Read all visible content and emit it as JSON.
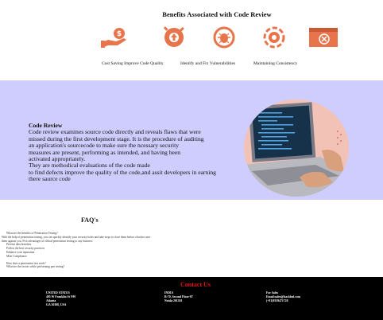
{
  "benefits": {
    "title": "Benefits Associated with Code Review",
    "items": [
      {
        "label": "Cost Saving Improve Code Quality",
        "icon": "dollar-hand-icon"
      },
      {
        "label": "",
        "icon": "cloud-upload-icon"
      },
      {
        "label": "Identify and Fix Vulnerabilities",
        "icon": "bug-icon"
      },
      {
        "label": "Maintaining Consistency",
        "icon": "gear-refresh-icon"
      },
      {
        "label": "",
        "icon": "browser-error-icon"
      }
    ],
    "icon_color": "#e8744c"
  },
  "review": {
    "heading": "Code Review",
    "lines": [
      "Code review examines source code directly and reveals flaws that were",
      "missed during the first development stage. It is the procedure of auditing",
      "an application's sourcecode to make sure the ncessary security",
      "measures are present, performing as intended, and having been",
      "activated appropriately.",
      "They are methodical evaluations of the code made",
      "to find defects improve the quality of the code,and assit developers in earning",
      "there saurce code"
    ],
    "band_color": "#cfcdfd"
  },
  "faq": {
    "title": "FAQ's",
    "lines": [
      "What are the benefits of Penetration Testing?",
      "With the help of penetration testing, you can quickly identify your security holes and take steps to close them before a hacker uses",
      "them against you. Five advantages of ethical penetration testing to any business",
      "Prevent data breaches",
      "Follow the best security practices",
      "Enhance your reputation",
      "Meet Compliance",
      "",
      "How does a penetration test work?",
      "What are the factors while performing pen testing?"
    ]
  },
  "footer": {
    "title": "Contact Us",
    "columns": [
      {
        "lines": [
          "UNITED STATES",
          "495 W Franklin St NW",
          "Atlanta",
          "GA 30308, USA"
        ]
      },
      {
        "lines": [
          "INDIA",
          "B-70, Second Floor-07",
          "Noida-201301"
        ]
      },
      {
        "lines": [
          "For Sales",
          "Email:sales@hackbul.com",
          "(+91)9359471720"
        ]
      }
    ]
  }
}
